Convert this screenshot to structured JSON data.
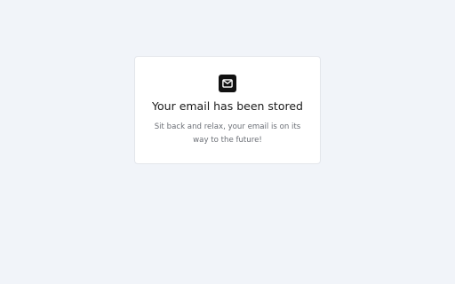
{
  "card": {
    "icon": "mail-icon",
    "title": "Your email has been stored",
    "message": "Sit back and relax, your email is on its way to the future!"
  },
  "colors": {
    "background": "#f1f4f9",
    "card": "#ffffff",
    "icon_box": "#111111",
    "title": "#1a1a1a",
    "message": "#6b6f76"
  }
}
